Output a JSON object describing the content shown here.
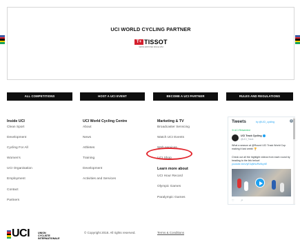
{
  "partner": {
    "title": "UCI WORLD CYCLING PARTNER",
    "logo_mark": "T+",
    "logo_word": "TISSOT",
    "logo_tagline": "SWISS WATCHES SINCE 1853"
  },
  "stripe_colors": [
    "#3b5ba7",
    "#e2262d",
    "#000000",
    "#f4d000",
    "#19a35b"
  ],
  "buttons": [
    "ALL COMPETITIONS",
    "HOST A UCI EVENT",
    "BECOME A UCI PARTNER",
    "RULES AND REGULATIONS"
  ],
  "columns": {
    "inside": {
      "heading": "Inside UCI",
      "links": [
        "Clean Sport",
        "Development",
        "Cycling For All",
        "Women's",
        "UCI Organisation",
        "Employment",
        "Contact",
        "Partners"
      ]
    },
    "centre": {
      "heading": "UCI World Cycling Centre",
      "links": [
        "About",
        "News",
        "Athletes",
        "Training",
        "Development",
        "Activities and Services"
      ]
    },
    "marketing": {
      "heading": "Marketing & TV",
      "links": [
        "Broadcaster Servicing",
        "Watch UCI Events",
        "Web services",
        "UCI Shop"
      ],
      "subheading": "Learn more about",
      "more_links": [
        "UCI Hour Record",
        "Olympic Games",
        "Paralympic Games"
      ]
    }
  },
  "twitter": {
    "title": "Tweets",
    "by": "by @UCI_cycling",
    "retweet": "UCI Retweeted",
    "name": "UCI Track Cycling",
    "handle": "@UCI_Track",
    "text1": "What a season at @Round UCI Track World Cup making it last week! 🏆",
    "text2_plain": "Check out all the highlight videos from each round by heading to the link below!",
    "text2_link": "youtube.be/v/yE3qNNzRs9kyhE",
    "actions": "♡ ↗",
    "accent": "#1da1f2"
  },
  "footer": {
    "logo": "UCI",
    "union_lines": [
      "UNION",
      "CYCLISTE",
      "INTERNATIONALE"
    ],
    "copyright": "© Copyright 2018. All rights reserved.",
    "terms": "Terms & Conditions"
  },
  "highlight_color": "#e2262d"
}
